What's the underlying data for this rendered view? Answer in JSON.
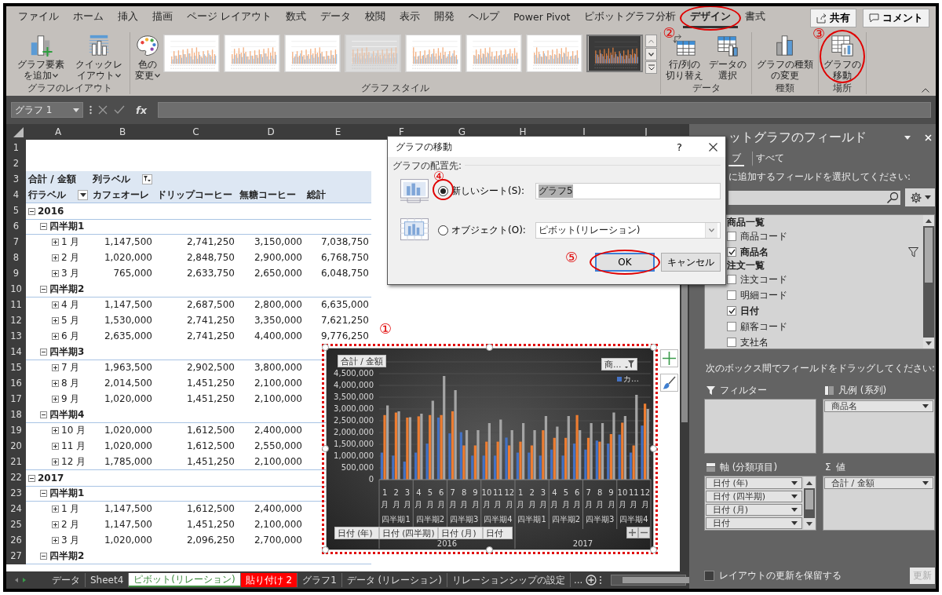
{
  "ribbon_tabs": [
    {
      "label": "ファイル",
      "selected": false
    },
    {
      "label": "ホーム",
      "selected": false
    },
    {
      "label": "挿入",
      "selected": false
    },
    {
      "label": "描画",
      "selected": false
    },
    {
      "label": "ページ レイアウト",
      "selected": false
    },
    {
      "label": "数式",
      "selected": false
    },
    {
      "label": "データ",
      "selected": false
    },
    {
      "label": "校閲",
      "selected": false
    },
    {
      "label": "表示",
      "selected": false
    },
    {
      "label": "開発",
      "selected": false
    },
    {
      "label": "ヘルプ",
      "selected": false
    },
    {
      "label": "Power Pivot",
      "selected": false
    },
    {
      "label": "ピボットグラフ分析",
      "selected": false
    },
    {
      "label": "デザイン",
      "selected": true,
      "circled": true,
      "callout": "②"
    },
    {
      "label": "書式",
      "selected": false
    }
  ],
  "share_button": "共有",
  "comment_button": "コメント",
  "ribbon_groups": [
    {
      "label": "グラフのレイアウト",
      "commands": [
        {
          "label": "グラフ要素を追加",
          "dropdown": true
        },
        {
          "label": "クイックレイアウト",
          "dropdown": true
        }
      ]
    },
    {
      "label": "グラフ スタイル",
      "commands": [
        {
          "label": "色の変更",
          "dropdown": true
        }
      ],
      "gallery": [
        {
          "kind": "light",
          "selected": false
        },
        {
          "kind": "light",
          "selected": false
        },
        {
          "kind": "light",
          "selected": false
        },
        {
          "kind": "shaded",
          "selected": false
        },
        {
          "kind": "light",
          "selected": false
        },
        {
          "kind": "light",
          "selected": false
        },
        {
          "kind": "light",
          "selected": false
        },
        {
          "kind": "dark",
          "selected": true
        }
      ]
    },
    {
      "label": "データ",
      "commands": [
        {
          "label": "行/列の切り替え",
          "dropdown": false
        },
        {
          "label": "データの選択",
          "dropdown": false
        }
      ]
    },
    {
      "label": "種類",
      "commands": [
        {
          "label": "グラフの種類の変更",
          "dropdown": false
        }
      ]
    },
    {
      "label": "場所",
      "commands": [
        {
          "label": "グラフの移動",
          "dropdown": false,
          "circled": true,
          "callout": "③"
        }
      ]
    }
  ],
  "formula_bar": {
    "name_box": "グラフ 1",
    "function_label": "fx"
  },
  "sheet": {
    "columns": [
      "A",
      "B",
      "C",
      "D",
      "E",
      "F",
      "G",
      "H",
      "I",
      "J"
    ],
    "rows": [
      {
        "number": "1",
        "kind": "blank"
      },
      {
        "number": "2",
        "kind": "blank"
      },
      {
        "number": "3",
        "kind": "values-header",
        "label": "合計 / 金額",
        "column_label": "列ラベル"
      },
      {
        "number": "4",
        "kind": "column-header",
        "label": "行ラベル",
        "columns": [
          "カフェオーレ",
          "ドリップコーヒー",
          "無糖コーヒー",
          "総計"
        ]
      },
      {
        "number": "5",
        "kind": "year",
        "label": "2016",
        "expanded": true
      },
      {
        "number": "6",
        "kind": "quarter",
        "label": "四半期1",
        "expanded": true
      },
      {
        "number": "7",
        "kind": "month",
        "label": "1 月",
        "expanded": false,
        "values": [
          "1,147,500",
          "2,741,250",
          "3,150,000",
          "7,038,750"
        ]
      },
      {
        "number": "8",
        "kind": "month",
        "label": "2 月",
        "expanded": false,
        "values": [
          "1,020,000",
          "2,848,750",
          "2,900,000",
          "6,768,750"
        ]
      },
      {
        "number": "9",
        "kind": "month",
        "label": "3 月",
        "expanded": false,
        "values": [
          "765,000",
          "2,633,750",
          "2,650,000",
          "6,048,750"
        ]
      },
      {
        "number": "10",
        "kind": "quarter",
        "label": "四半期2",
        "expanded": true
      },
      {
        "number": "11",
        "kind": "month",
        "label": "4 月",
        "expanded": false,
        "values": [
          "1,147,500",
          "2,687,500",
          "2,800,000",
          "6,635,000"
        ]
      },
      {
        "number": "12",
        "kind": "month",
        "label": "5 月",
        "expanded": false,
        "values": [
          "1,530,000",
          "2,741,250",
          "3,350,000",
          "7,621,250"
        ]
      },
      {
        "number": "13",
        "kind": "month",
        "label": "6 月",
        "expanded": false,
        "values": [
          "2,635,000",
          "2,741,250",
          "4,400,000",
          "9,776,250"
        ]
      },
      {
        "number": "14",
        "kind": "quarter",
        "label": "四半期3",
        "expanded": true
      },
      {
        "number": "15",
        "kind": "month",
        "label": "7 月",
        "expanded": false,
        "values": [
          "1,963,500",
          "2,902,500",
          "3,800,000"
        ]
      },
      {
        "number": "16",
        "kind": "month",
        "label": "8 月",
        "expanded": false,
        "values": [
          "2,014,500",
          "1,451,250",
          "2,100,000"
        ]
      },
      {
        "number": "17",
        "kind": "month",
        "label": "9 月",
        "expanded": false,
        "values": [
          "1,020,000",
          "1,451,250",
          "2,100,000"
        ]
      },
      {
        "number": "18",
        "kind": "quarter",
        "label": "四半期4",
        "expanded": true
      },
      {
        "number": "19",
        "kind": "month",
        "label": "10 月",
        "expanded": false,
        "values": [
          "1,020,000",
          "1,612,500",
          "2,400,000"
        ]
      },
      {
        "number": "20",
        "kind": "month",
        "label": "11 月",
        "expanded": false,
        "values": [
          "1,020,000",
          "1,612,500",
          "2,550,000"
        ]
      },
      {
        "number": "21",
        "kind": "month",
        "label": "12 月",
        "expanded": false,
        "values": [
          "1,785,000",
          "1,451,250",
          "2,100,000"
        ]
      },
      {
        "number": "22",
        "kind": "year",
        "label": "2017",
        "expanded": true
      },
      {
        "number": "23",
        "kind": "quarter",
        "label": "四半期1",
        "expanded": true
      },
      {
        "number": "24",
        "kind": "month",
        "label": "1 月",
        "expanded": false,
        "values": [
          "1,147,500",
          "1,612,500",
          "2,400,000"
        ]
      },
      {
        "number": "25",
        "kind": "month",
        "label": "2 月",
        "expanded": false,
        "values": [
          "1,147,500",
          "1,451,250",
          "2,100,000"
        ]
      },
      {
        "number": "26",
        "kind": "month",
        "label": "3 月",
        "expanded": false,
        "values": [
          "1,020,000",
          "2,096,250",
          "2,700,000"
        ]
      },
      {
        "number": "27",
        "kind": "quarter",
        "label": "四半期2",
        "expanded": true
      }
    ]
  },
  "chart": {
    "selected": true,
    "highlighted": true,
    "callout": "①",
    "value_button": "合計 / 金額",
    "legend_button": "商…",
    "legend": [
      {
        "label": "カ…",
        "color": "#4472c4"
      }
    ],
    "axis_buttons": [
      "日付 (年)",
      "日付 (四半期)",
      "日付 (月)",
      "日付"
    ],
    "quarters": [
      "四半期1",
      "四半期2",
      "四半期3",
      "四半期4",
      "四半期1",
      "四半期2",
      "四半期3",
      "四半期4"
    ],
    "years": [
      "2016",
      "2017"
    ],
    "chart_data": {
      "type": "bar",
      "categories": [
        "1 月",
        "2 月",
        "3 月",
        "4 月",
        "5 月",
        "6 月",
        "7 月",
        "8 月",
        "9 月",
        "10 月",
        "11 月",
        "12 月",
        "1 月",
        "2 月",
        "3 月",
        "4 月",
        "5 月",
        "6 月",
        "7 月",
        "8 月",
        "9 月",
        "10 月",
        "11 月",
        "12 月"
      ],
      "series": [
        {
          "color": "#4472c4",
          "values": [
            1147500,
            1020000,
            765000,
            1147500,
            1530000,
            2635000,
            1963500,
            2014500,
            1020000,
            1020000,
            1020000,
            1785000,
            1147500,
            1147500,
            1020000,
            1275000,
            1020000,
            1530000,
            1275000,
            1657500,
            1530000,
            1912500,
            1147500,
            2295000
          ]
        },
        {
          "color": "#ed7d31",
          "values": [
            2741250,
            2848750,
            2633750,
            2687500,
            2741250,
            2741250,
            2902500,
            1451250,
            1451250,
            1612500,
            1612500,
            1451250,
            1612500,
            1451250,
            2096250,
            1773750,
            1773750,
            2741250,
            1773750,
            1612500,
            1935000,
            2418750,
            1451250,
            3225000
          ]
        },
        {
          "color": "#a5a5a5",
          "values": [
            3150000,
            2900000,
            2650000,
            2800000,
            3350000,
            4400000,
            3800000,
            2100000,
            2100000,
            2400000,
            2550000,
            2100000,
            2400000,
            2100000,
            2700000,
            2250000,
            2700000,
            2100000,
            2400000,
            2400000,
            2850000,
            2700000,
            3600000,
            3000000
          ]
        }
      ],
      "grid": true,
      "ylim": [
        0,
        5000000
      ],
      "yticks": [
        {
          "value": 0,
          "label": "0"
        },
        {
          "value": 500000,
          "label": "500,000"
        },
        {
          "value": 1000000,
          "label": "1,000,000"
        },
        {
          "value": 1500000,
          "label": "1,500,000"
        },
        {
          "value": 2000000,
          "label": "2,000,000"
        },
        {
          "value": 2500000,
          "label": "2,500,000"
        },
        {
          "value": 3000000,
          "label": "3,000,000"
        },
        {
          "value": 3500000,
          "label": "3,500,000"
        },
        {
          "value": 4000000,
          "label": "4,000,000"
        },
        {
          "value": 4500000,
          "label": "4,500,000"
        }
      ]
    }
  },
  "dialog": {
    "title": "グラフの移動",
    "help": "?",
    "section_label": "グラフの配置先:",
    "options": [
      {
        "label": "新しいシート(S):",
        "selected": true,
        "kind": "text",
        "value": "グラフ5",
        "circled": true,
        "callout": "④"
      },
      {
        "label": "オブジェクト(O):",
        "selected": false,
        "kind": "select",
        "value": "ピボット(リレーション)"
      }
    ],
    "buttons": [
      {
        "label": "OK",
        "default": true,
        "circled": true,
        "callout": "⑤"
      },
      {
        "label": "キャンセル",
        "default": false
      }
    ]
  },
  "field_panel": {
    "title": "ットグラフのフィールド",
    "tabs": [
      {
        "label": "ブ",
        "selected": true
      },
      {
        "label": "すべて",
        "selected": false
      }
    ],
    "instruction": "に追加するフィールドを選択してください:",
    "field_groups": [
      {
        "label": "商品一覧",
        "fields": [
          {
            "label": "商品コード",
            "checked": false,
            "filtered": false
          },
          {
            "label": "商品名",
            "checked": true,
            "filtered": true
          }
        ]
      },
      {
        "label": "注文一覧",
        "fields": [
          {
            "label": "注文コード",
            "checked": false,
            "filtered": false
          },
          {
            "label": "明細コード",
            "checked": false,
            "filtered": false
          },
          {
            "label": "日付",
            "checked": true,
            "filtered": false
          },
          {
            "label": "顧客コード",
            "checked": false,
            "filtered": false
          },
          {
            "label": "支社名",
            "checked": false,
            "filtered": false
          }
        ]
      }
    ],
    "drag_hint": "次のボックス間でフィールドをドラッグしてください:",
    "areas": [
      {
        "label": "フィルター",
        "kind": "filter"
      },
      {
        "label": "凡例 (系列)",
        "kind": "legend",
        "items": [
          "商品名"
        ]
      },
      {
        "label": "軸 (分類項目)",
        "kind": "axis",
        "items": [
          "日付 (年)",
          "日付 (四半期)",
          "日付 (月)",
          "日付"
        ]
      },
      {
        "label": "値",
        "kind": "values",
        "symbol": "Σ",
        "items": [
          "合計 / 金額"
        ]
      }
    ],
    "defer_update": {
      "label": "レイアウトの更新を保留する",
      "checked": false
    },
    "update_button": {
      "label": "更新",
      "disabled": true
    }
  },
  "sheet_tabs": [
    {
      "label": "データ",
      "selected": false
    },
    {
      "label": "Sheet4",
      "selected": false
    },
    {
      "label": "ピボット(リレーション)",
      "selected": true
    },
    {
      "label": "貼り付け 2",
      "selected": false,
      "color": "#ff0000"
    },
    {
      "label": "グラフ1",
      "selected": false
    },
    {
      "label": "データ (リレーション)",
      "selected": false
    },
    {
      "label": "リレーションシップの設定",
      "selected": false
    }
  ],
  "more_tabs": "..."
}
